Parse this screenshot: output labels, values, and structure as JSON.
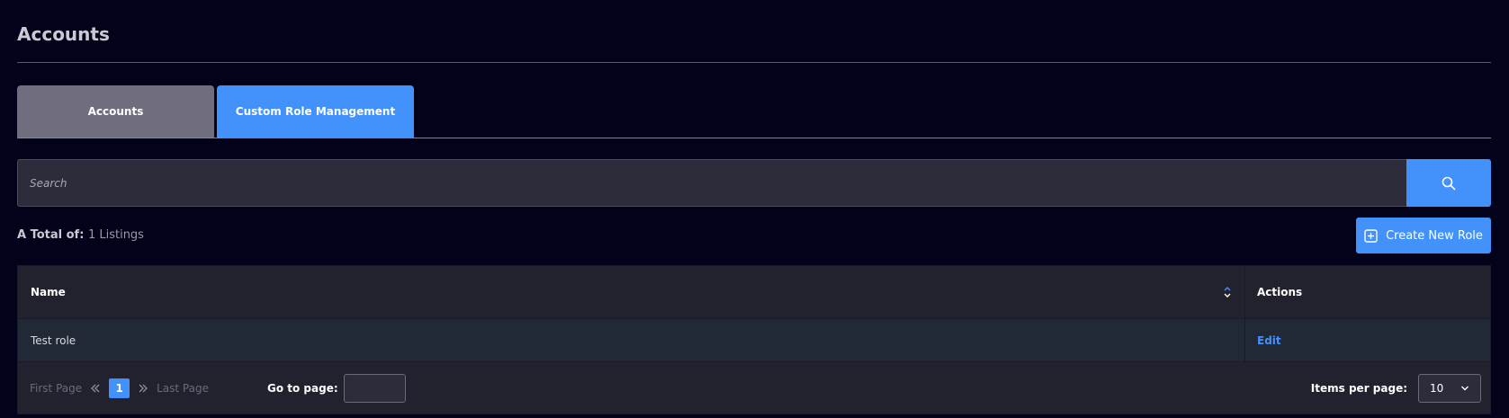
{
  "header": {
    "title": "Accounts"
  },
  "tabs": [
    {
      "label": "Accounts",
      "active": false
    },
    {
      "label": "Custom Role Management",
      "active": true
    }
  ],
  "search": {
    "placeholder": "Search",
    "value": ""
  },
  "totals": {
    "prefix": "A Total of:",
    "count_text": "1 Listings"
  },
  "create_button": {
    "label": "Create New Role"
  },
  "table": {
    "columns": {
      "name": "Name",
      "actions": "Actions"
    },
    "rows": [
      {
        "name": "Test role",
        "action": "Edit"
      }
    ]
  },
  "pagination": {
    "first_label": "First Page",
    "last_label": "Last Page",
    "current_page": "1",
    "goto_label": "Go to page:",
    "goto_value": "",
    "items_per_page_label": "Items per page:",
    "items_per_page_value": "10"
  },
  "colors": {
    "background": "#02031a",
    "accent": "#4391fb",
    "inactive_tab": "#6f6d7e",
    "panel": "#22212e",
    "row": "#222936"
  },
  "icons": {
    "search": "search-icon",
    "create": "plus-square-icon",
    "sort": "sort-icon",
    "prev": "double-chevron-left-icon",
    "next": "double-chevron-right-icon",
    "dropdown": "chevron-down-icon"
  }
}
